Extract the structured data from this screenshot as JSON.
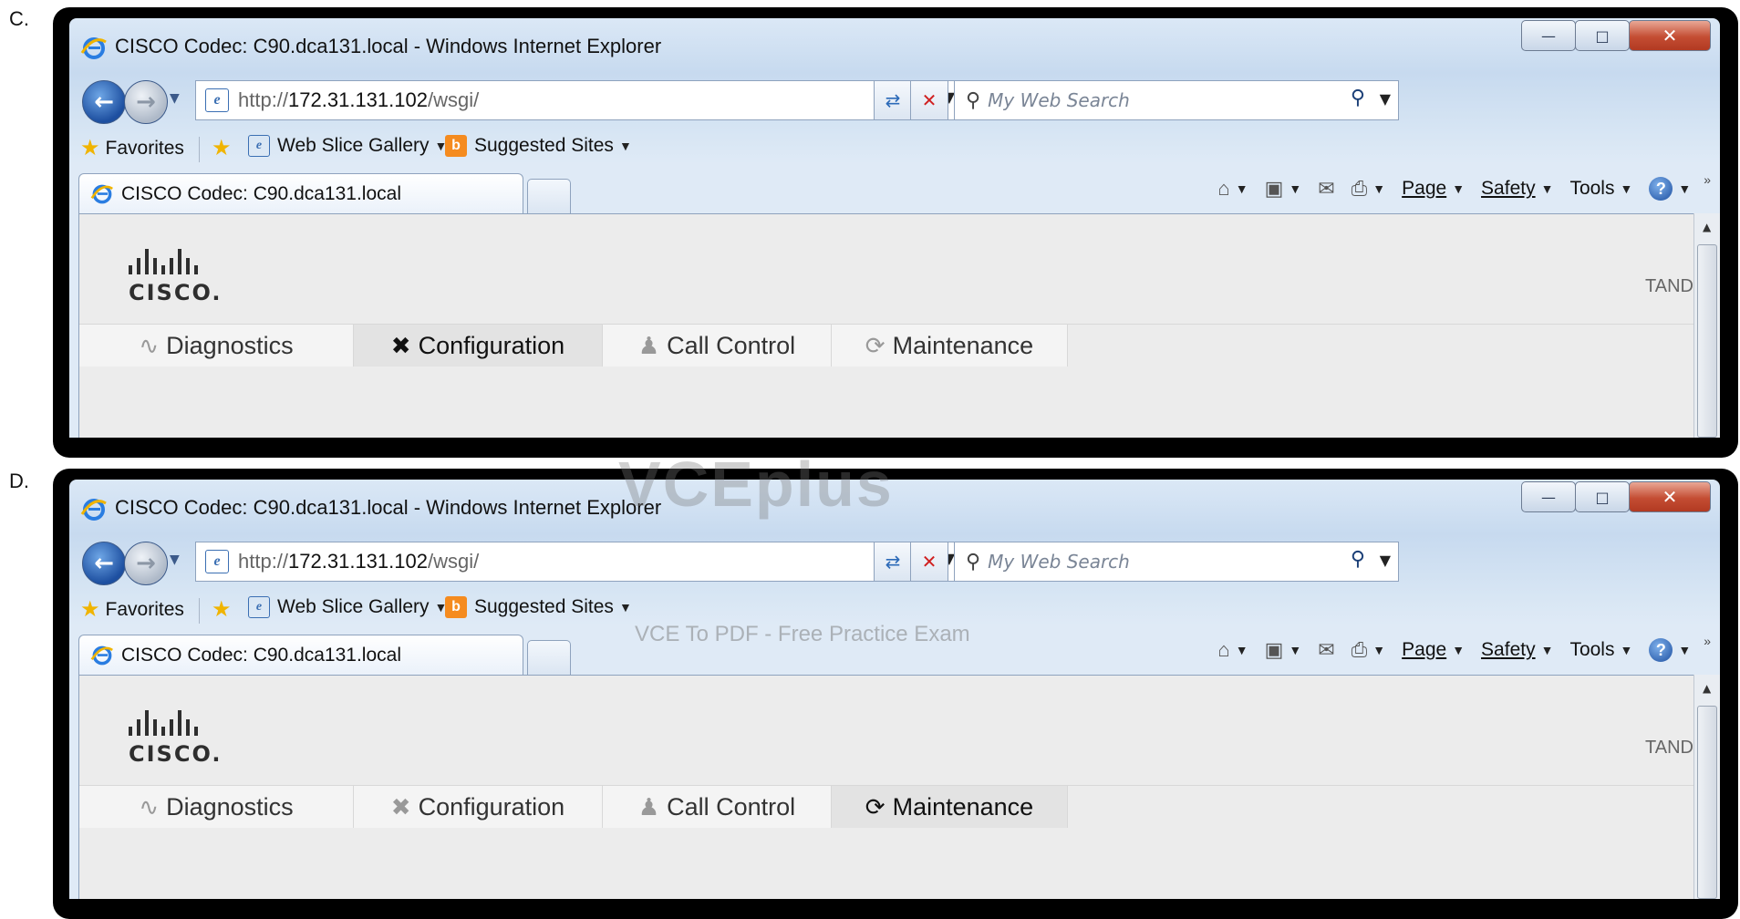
{
  "options": [
    {
      "letter": "C.",
      "window_title": "CISCO Codec: C90.dca131.local - Windows Internet Explorer",
      "url_prefix": "http://",
      "url_host": "172.31.131.102",
      "url_path": "/wsgi/",
      "search_placeholder": "My Web Search",
      "favorites_label": "Favorites",
      "web_slice_label": "Web Slice Gallery",
      "suggested_sites_label": "Suggested Sites",
      "tab_label": "CISCO Codec: C90.dca131.local",
      "cmd_page": "Page",
      "cmd_safety": "Safety",
      "cmd_tools": "Tools",
      "logo_text": "CISCO.",
      "right_text": "TAND",
      "nav": [
        "Diagnostics",
        "Configuration",
        "Call Control",
        "Maintenance"
      ],
      "active_nav": "Configuration"
    },
    {
      "letter": "D.",
      "window_title": "CISCO Codec: C90.dca131.local - Windows Internet Explorer",
      "url_prefix": "http://",
      "url_host": "172.31.131.102",
      "url_path": "/wsgi/",
      "search_placeholder": "My Web Search",
      "favorites_label": "Favorites",
      "web_slice_label": "Web Slice Gallery",
      "suggested_sites_label": "Suggested Sites",
      "tab_label": "CISCO Codec: C90.dca131.local",
      "cmd_page": "Page",
      "cmd_safety": "Safety",
      "cmd_tools": "Tools",
      "logo_text": "CISCO.",
      "right_text": "TAND",
      "nav": [
        "Diagnostics",
        "Configuration",
        "Call Control",
        "Maintenance"
      ],
      "active_nav": "Maintenance"
    }
  ],
  "watermark": {
    "title": "VCEplus",
    "subtitle": "VCE To PDF - Free Practice Exam"
  },
  "colors": {
    "close_button": "#c44d33",
    "window_chrome": "#dbe8f6",
    "accent_blue": "#1d4fa0"
  }
}
